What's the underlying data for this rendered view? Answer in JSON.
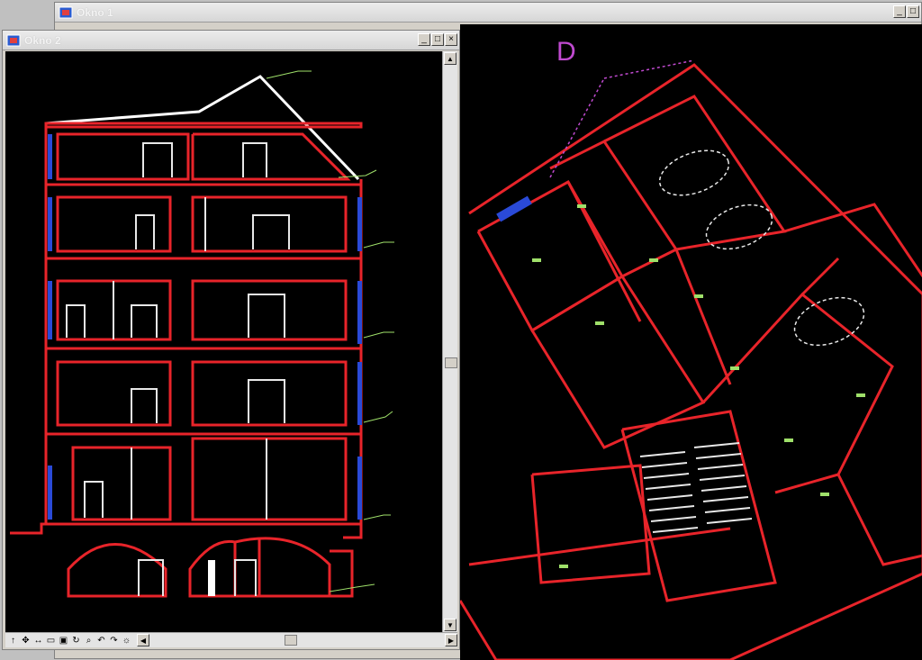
{
  "window1": {
    "title": "Okno 1"
  },
  "window2": {
    "title": "Okno 2"
  },
  "plan": {
    "section_label": "D"
  },
  "toolbar_icons": [
    "up-arrow-icon",
    "pan-icon",
    "zoom-icon",
    "window-icon",
    "fit-icon",
    "refresh-icon",
    "measure-icon",
    "undo-icon",
    "redo-icon",
    "settings-icon"
  ],
  "colors": {
    "walls": "#e8242a",
    "openings": "#e8e8e8",
    "glass": "#2a4ad8",
    "annotations": "#9fe06a",
    "background": "#000000"
  }
}
